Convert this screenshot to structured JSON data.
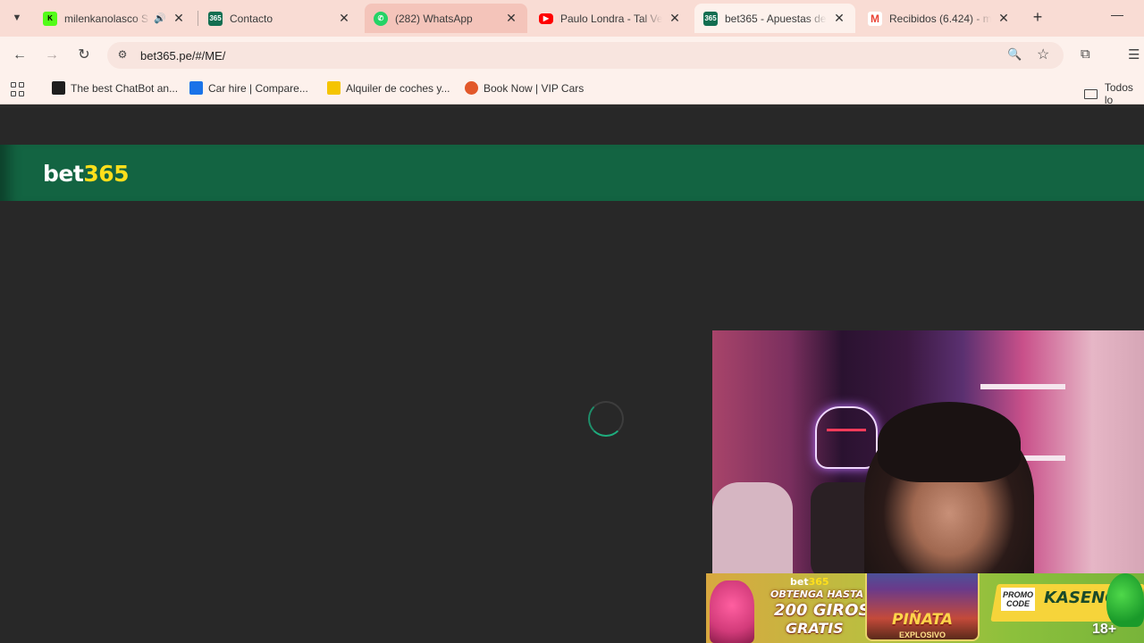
{
  "browser": {
    "tabs": [
      {
        "title": "milenkanolasco S",
        "favicon": "kick-icon",
        "color": "#53fc18",
        "muted_icon": "speaker-icon"
      },
      {
        "title": "Contacto",
        "favicon": "bet365-icon",
        "color": "#126e51"
      },
      {
        "title": "(282) WhatsApp",
        "favicon": "whatsapp-icon",
        "color": "#25d366"
      },
      {
        "title": "Paulo Londra - Tal Ve",
        "favicon": "youtube-icon",
        "color": "#ff0000"
      },
      {
        "title": "bet365 - Apuestas de",
        "favicon": "bet365-icon",
        "color": "#126e51"
      },
      {
        "title": "Recibidos (6.424) - m",
        "favicon": "gmail-icon",
        "color": "#ea4335"
      }
    ],
    "close_glyph": "✕",
    "newtab_glyph": "+",
    "minimize_glyph": "—",
    "url": "bet365.pe/#/ME/",
    "bookmarks": [
      {
        "label": "The best ChatBot an...",
        "color": "#1e1e1e"
      },
      {
        "label": "Car hire | Compare...",
        "color": "#1a73e8"
      },
      {
        "label": "Alquiler de coches y...",
        "color": "#f5c400"
      },
      {
        "label": "Book Now | VIP Cars",
        "color": "#e2582a"
      }
    ],
    "bookmarks_folder": "Todos lo"
  },
  "site": {
    "logo_text": "bet",
    "logo_num": "365",
    "brand_green": "#136442",
    "brand_yellow": "#ffdf1b"
  },
  "banner": {
    "logo_text": "bet",
    "logo_num": "365",
    "line1": "OBTENGA HASTA",
    "line2": "200 GIROS",
    "line3": "GRATIS",
    "game_name": "PIÑATA",
    "game_sub": "EXPLOSIVO",
    "promo_label": "PROMO CODE",
    "promo_code": "KASENG",
    "age_badge": "18+"
  }
}
